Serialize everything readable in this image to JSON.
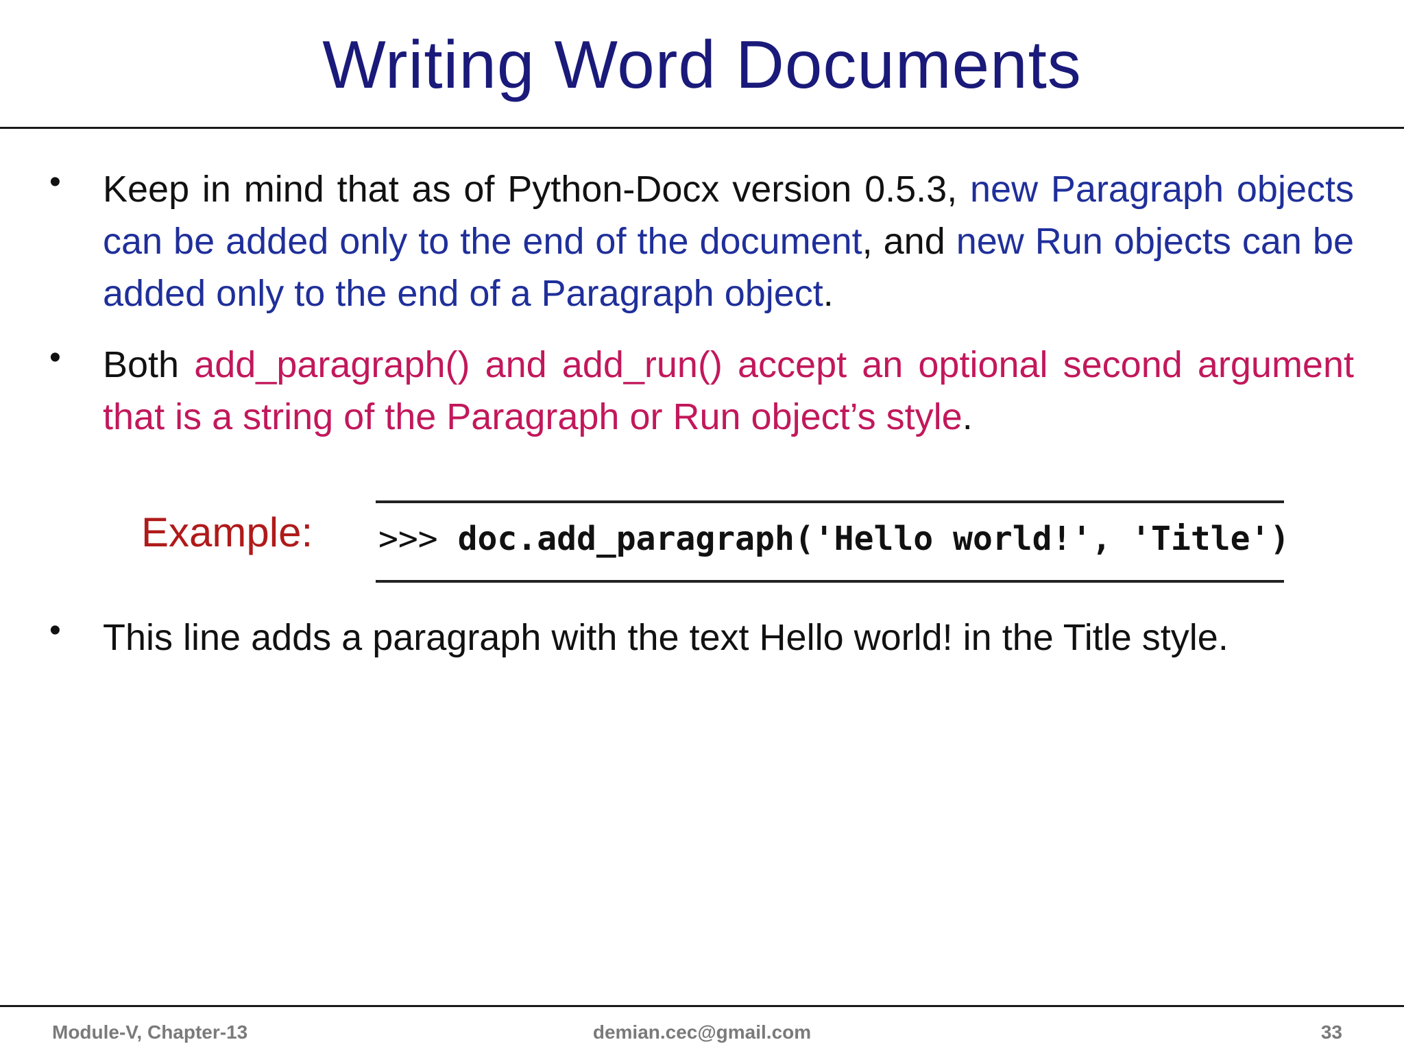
{
  "slide": {
    "title": "Writing Word Documents",
    "bullet1": {
      "lead": "Keep in mind that as of Python-Docx version 0.5.3, ",
      "highlight_a": "new Paragraph objects can be added only to the end of the document",
      "mid": ", and ",
      "highlight_b": "new Run objects can be added only to the end of a Paragraph object",
      "end": "."
    },
    "bullet2": {
      "lead": "Both ",
      "highlight": "add_paragraph() and add_run() accept an optional second argument that is a string of the Paragraph or Run object’s style",
      "end": "."
    },
    "example": {
      "label": "Example:",
      "prompt": ">>> ",
      "code": "doc.add_paragraph('Hello world!', 'Title')"
    },
    "bullet3": {
      "text": "This line adds a paragraph with the text Hello world! in the Title style."
    },
    "bullet_glyph": "•",
    "footer": {
      "left": "Module-V, Chapter-13",
      "center": "demian.cec@gmail.com",
      "right": "33"
    },
    "colors": {
      "title": "#1a1a7a",
      "blue_text": "#1f2f9a",
      "pink_text": "#c2185b",
      "example_label": "#b01a1a",
      "footer": "#7a7a7a"
    }
  }
}
